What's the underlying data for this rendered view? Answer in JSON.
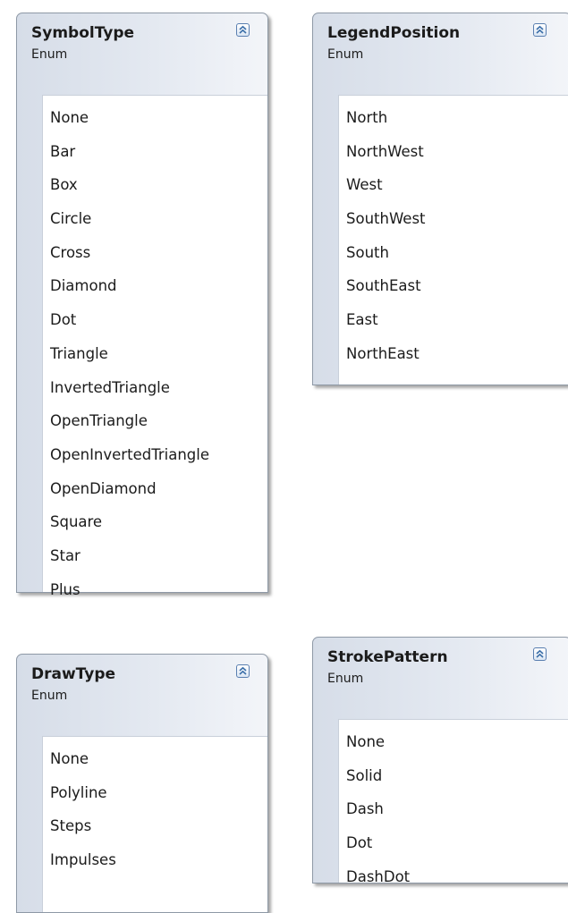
{
  "enums": {
    "symbol_type": {
      "title": "SymbolType",
      "kind": "Enum",
      "values": [
        "None",
        "Bar",
        "Box",
        "Circle",
        "Cross",
        "Diamond",
        "Dot",
        "Triangle",
        "InvertedTriangle",
        "OpenTriangle",
        "OpenInvertedTriangle",
        "OpenDiamond",
        "Square",
        "Star",
        "Plus"
      ]
    },
    "legend_position": {
      "title": "LegendPosition",
      "kind": "Enum",
      "values": [
        "North",
        "NorthWest",
        "West",
        "SouthWest",
        "South",
        "SouthEast",
        "East",
        "NorthEast"
      ]
    },
    "draw_type": {
      "title": "DrawType",
      "kind": "Enum",
      "values": [
        "None",
        "Polyline",
        "Steps",
        "Impulses"
      ]
    },
    "stroke_pattern": {
      "title": "StrokePattern",
      "kind": "Enum",
      "values": [
        "None",
        "Solid",
        "Dash",
        "Dot",
        "DashDot"
      ]
    }
  },
  "icons": {
    "collapse": "double-chevron-up-icon"
  },
  "colors": {
    "header_gradient_left": "#d6dde8",
    "header_gradient_right": "#f3f5f9",
    "border": "#8e99a6",
    "collapse_button": "#3a6ea8"
  }
}
